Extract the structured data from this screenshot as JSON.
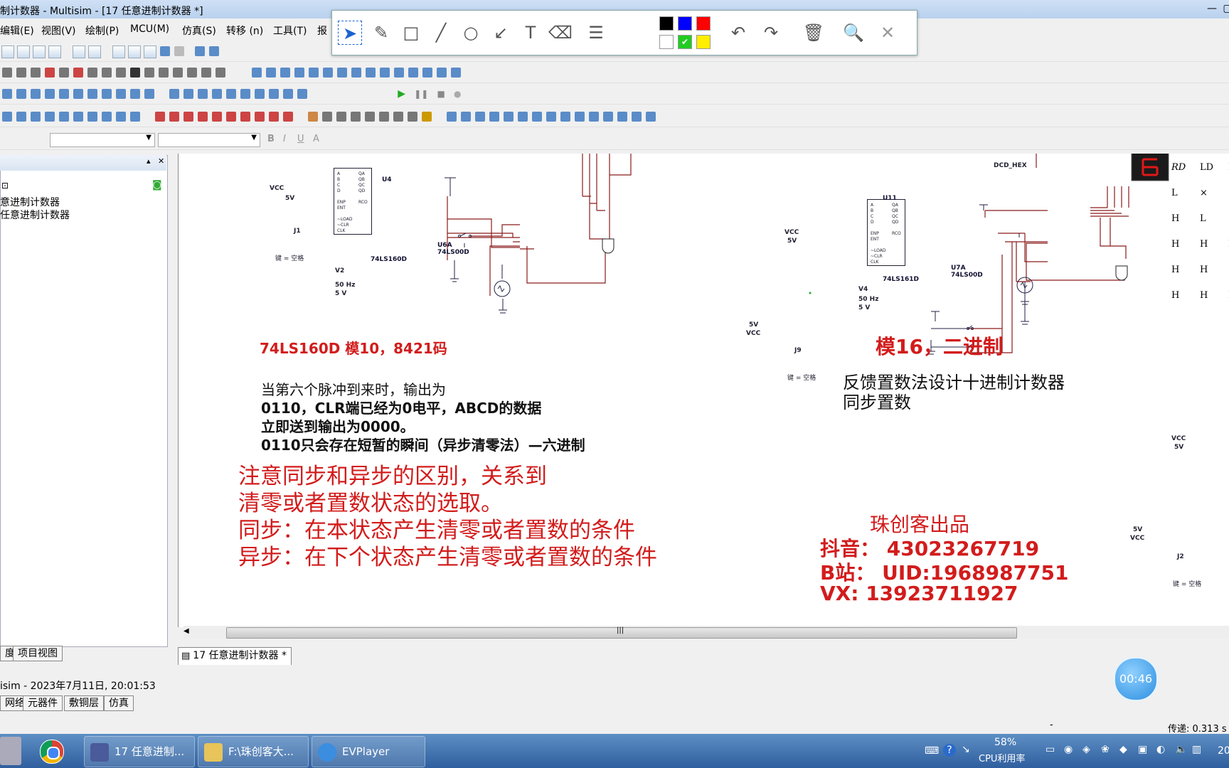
{
  "window": {
    "title": "制计数器 - Multisim - [17 任意进制计数器 *]"
  },
  "menu": [
    "编辑(E)",
    "视图(V)",
    "绘制(P)",
    "MCU(M)",
    "仿真(S)",
    "转移 (n)",
    "工具(T)",
    "报"
  ],
  "project_tree": {
    "items": [
      "意进制计数器",
      "任意进制计数器"
    ]
  },
  "left_tabs": [
    "度",
    "项目视图"
  ],
  "doc_tab": "17 任意进制计数器 *",
  "status": {
    "log": "isim  -  2023年7月11日, 20:01:53",
    "transfer": "传递: 0.313 s"
  },
  "bottom_tabs": [
    "网络",
    "元器件",
    "敷铜层",
    "仿真"
  ],
  "timer": "00:46",
  "annotation_colors": [
    "#000000",
    "#0000ff",
    "#ff0000",
    "#ffffff",
    "#22cc22",
    "#ffee00"
  ],
  "schematic": {
    "left": {
      "vcc": "VCC",
      "vcc_v": "5V",
      "chip": "U4",
      "chip_part": "74LS160D",
      "gate": "U6A",
      "gate_part": "74LS00D",
      "switch": "J1",
      "switch_key": "键 = 空格",
      "source": "V2",
      "source_f": "50 Hz",
      "source_v": "5 V"
    },
    "right": {
      "display": "DCD_HEX",
      "chip": "U11",
      "chip_part": "74LS161D",
      "gate": "U7A",
      "gate_part": "74LS00D",
      "vcc": "VCC",
      "vcc_v": "5V",
      "source": "V4",
      "source_f": "50 Hz",
      "source_v": "5 V",
      "vcc2_v": "5V",
      "vcc2": "VCC",
      "switch": "J9",
      "switch_key": "键 = 空格"
    },
    "far_right": {
      "vcc": "VCC",
      "vcc_v": "5V",
      "vcc2_v": "5V",
      "vcc2": "VCC",
      "switch": "J2",
      "switch_key": "键 = 空格"
    },
    "truth_table": {
      "headers": [
        "RD",
        "LD",
        "E"
      ],
      "rows": [
        [
          "L",
          "×",
          "×"
        ],
        [
          "H",
          "L",
          "×"
        ],
        [
          "H",
          "H",
          "L"
        ],
        [
          "H",
          "H",
          "×"
        ],
        [
          "H",
          "H",
          "H"
        ]
      ]
    }
  },
  "notes": {
    "title_left": "74LS160D  模10，8421码",
    "title_right": "模16，二进制",
    "black_lines": [
      "当第六个脉冲到来时，输出为",
      "0110，CLR端已经为0电平，ABCD的数据",
      "立即送到输出为0000。",
      "0110只会存在短暂的瞬间（异步清零法）—六进制"
    ],
    "right_lines": [
      "反馈置数法设计十进制计数器",
      "同步置数"
    ],
    "red_lines": [
      "注意同步和异步的区别，关系到",
      "清零或者置数状态的选取。",
      "同步：在本状态产生清零或者置数的条件",
      "异步：在下个状态产生清零或者置数的条件"
    ],
    "credits": [
      "珠创客出品",
      "抖音：   43023267719",
      "B站：  UID:1968987751",
      "VX:     13923711927"
    ]
  },
  "taskbar": {
    "items": [
      "17 任意进制...",
      "F:\\珠创客大...",
      "EVPlayer"
    ],
    "cpu_percent": "58%",
    "cpu_label": "CPU利用率",
    "clock": "20"
  }
}
